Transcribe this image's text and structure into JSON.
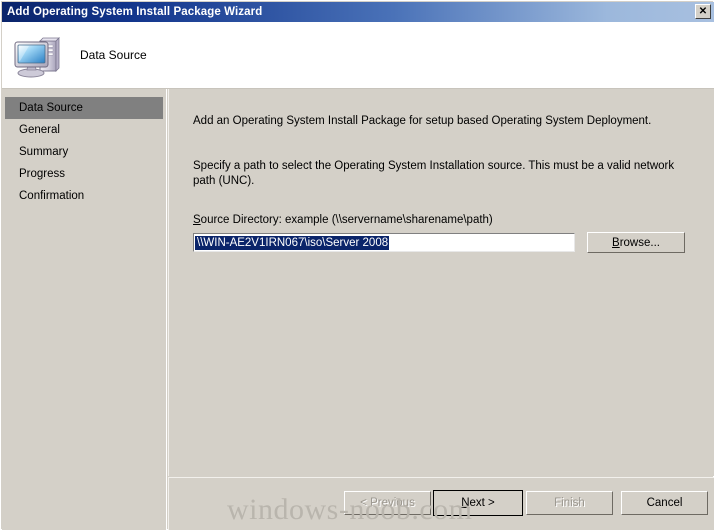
{
  "window": {
    "title": "Add Operating System Install Package Wizard",
    "close_label": "✕"
  },
  "header": {
    "title": "Data Source",
    "icon": "computer-server-icon"
  },
  "sidebar": {
    "items": [
      {
        "label": "Data Source",
        "selected": true
      },
      {
        "label": "General",
        "selected": false
      },
      {
        "label": "Summary",
        "selected": false
      },
      {
        "label": "Progress",
        "selected": false
      },
      {
        "label": "Confirmation",
        "selected": false
      }
    ]
  },
  "main": {
    "intro_text": "Add an Operating System Install Package for setup based Operating System Deployment.",
    "specify_text": "Specify a path to select the Operating System Installation source. This must be a valid network path (UNC).",
    "field": {
      "label_accel": "S",
      "label_rest": "ource Directory: example (\\\\servername\\sharename\\path)",
      "value": "\\\\WIN-AE2V1IRN067\\iso\\Server 2008",
      "placeholder": ""
    },
    "browse": {
      "accel": "B",
      "rest": "rowse..."
    }
  },
  "buttons": {
    "previous": {
      "label": "< Previous",
      "disabled": true,
      "default": false
    },
    "next": {
      "accel": "N",
      "pre": "",
      "rest": "ext >",
      "disabled": false,
      "default": true
    },
    "finish": {
      "label": "Finish",
      "disabled": true,
      "default": false
    },
    "cancel": {
      "label": "Cancel",
      "disabled": false,
      "default": false
    }
  },
  "watermark": {
    "text": "windows-noob.com"
  },
  "colors": {
    "titlebar_start": "#0a246a",
    "titlebar_end": "#a8c0e0",
    "face": "#d4d0c8",
    "selection": "#0a246a",
    "nav_selected": "#808080",
    "disabled_text": "#9a968e"
  }
}
